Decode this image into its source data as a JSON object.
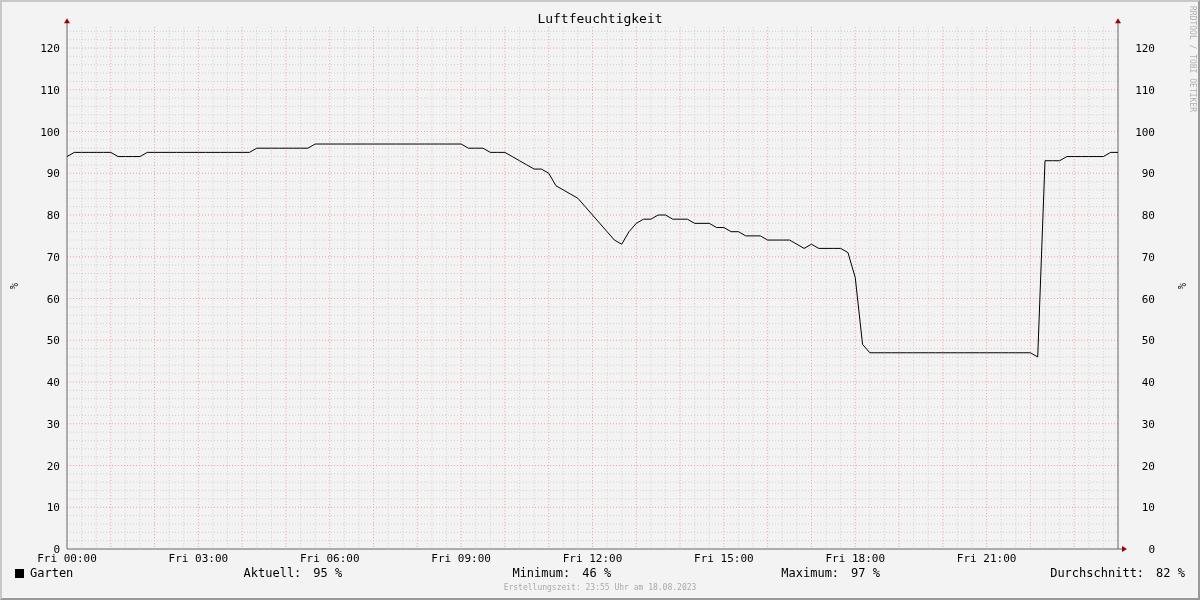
{
  "title": "Luftfeuchtigkeit",
  "watermark": "RRDTOOL / TOBI OETIKER",
  "chart_data": {
    "type": "line",
    "ylabel": "%",
    "ylim": [
      0,
      125
    ],
    "grid": true,
    "yticks": [
      0,
      10,
      20,
      30,
      40,
      50,
      60,
      70,
      80,
      90,
      100,
      110,
      120
    ],
    "categories": [
      "Fri 00:00",
      null,
      null,
      null,
      null,
      null,
      null,
      null,
      null,
      null,
      null,
      null,
      null,
      null,
      null,
      null,
      null,
      null,
      "Fri 03:00",
      null,
      null,
      null,
      null,
      null,
      null,
      null,
      null,
      null,
      null,
      null,
      null,
      null,
      null,
      null,
      null,
      null,
      "Fri 06:00",
      null,
      null,
      null,
      null,
      null,
      null,
      null,
      null,
      null,
      null,
      null,
      null,
      null,
      null,
      null,
      null,
      null,
      "Fri 09:00",
      null,
      null,
      null,
      null,
      null,
      null,
      null,
      null,
      null,
      null,
      null,
      null,
      null,
      null,
      null,
      null,
      null,
      "Fri 12:00",
      null,
      null,
      null,
      null,
      null,
      null,
      null,
      null,
      null,
      null,
      null,
      null,
      null,
      null,
      null,
      null,
      null,
      "Fri 15:00",
      null,
      null,
      null,
      null,
      null,
      null,
      null,
      null,
      null,
      null,
      null,
      null,
      null,
      null,
      null,
      null,
      null,
      "Fri 18:00",
      null,
      null,
      null,
      null,
      null,
      null,
      null,
      null,
      null,
      null,
      null,
      null,
      null,
      null,
      null,
      null,
      null,
      "Fri 21:00",
      null,
      null,
      null,
      null,
      null,
      null,
      null,
      null,
      null,
      null,
      null,
      null,
      null,
      null,
      null,
      null,
      null,
      null
    ],
    "series": [
      {
        "name": "Garten",
        "color": "#000000",
        "values": [
          94,
          95,
          95,
          95,
          95,
          95,
          95,
          94,
          94,
          94,
          94,
          95,
          95,
          95,
          95,
          95,
          95,
          95,
          95,
          95,
          95,
          95,
          95,
          95,
          95,
          95,
          96,
          96,
          96,
          96,
          96,
          96,
          96,
          96,
          97,
          97,
          97,
          97,
          97,
          97,
          97,
          97,
          97,
          97,
          97,
          97,
          97,
          97,
          97,
          97,
          97,
          97,
          97,
          97,
          97,
          96,
          96,
          96,
          95,
          95,
          95,
          94,
          93,
          92,
          91,
          91,
          90,
          87,
          86,
          85,
          84,
          82,
          80,
          78,
          76,
          74,
          73,
          76,
          78,
          79,
          79,
          80,
          80,
          79,
          79,
          79,
          78,
          78,
          78,
          77,
          77,
          76,
          76,
          75,
          75,
          75,
          74,
          74,
          74,
          74,
          73,
          72,
          73,
          72,
          72,
          72,
          72,
          71,
          65,
          49,
          47,
          47,
          47,
          47,
          47,
          47,
          47,
          47,
          47,
          47,
          47,
          47,
          47,
          47,
          47,
          47,
          47,
          47,
          47,
          47,
          47,
          47,
          47,
          46,
          93,
          93,
          93,
          94,
          94,
          94,
          94,
          94,
          94,
          95,
          95
        ]
      }
    ]
  },
  "right_axis_labels": [
    "120",
    "110",
    "100",
    "90",
    "80",
    "70",
    "60",
    "50",
    "40",
    "30",
    "20",
    "10",
    "0"
  ],
  "stats": [
    {
      "label": "Aktuell:",
      "value": "95 %"
    },
    {
      "label": "Minimum:",
      "value": "46 %"
    },
    {
      "label": "Maximum:",
      "value": "97 %"
    },
    {
      "label": "Durchschnitt:",
      "value": "82 %"
    }
  ],
  "footer": "Erstellungszeit: 23:55 Uhr am 18.08.2023"
}
